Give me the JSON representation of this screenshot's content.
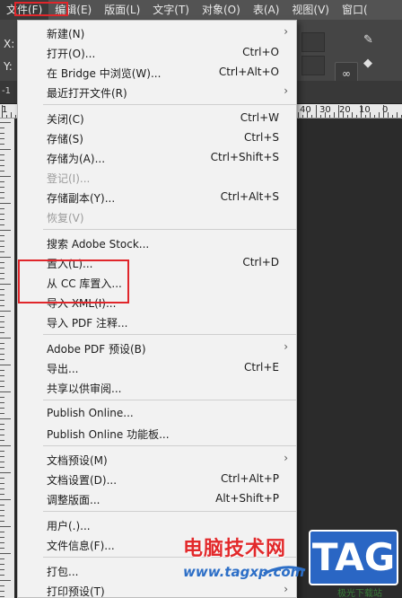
{
  "menubar": {
    "items": [
      "文件(F)",
      "编辑(E)",
      "版面(L)",
      "文字(T)",
      "对象(O)",
      "表(A)",
      "视图(V)",
      "窗口("
    ]
  },
  "control_bar": {
    "x_label": "X:",
    "y_label": "Y:"
  },
  "tabbar": {
    "label": "-1"
  },
  "ruler": {
    "numbers": [
      "1",
      "40",
      "30",
      "20",
      "10",
      "0"
    ]
  },
  "file_menu": {
    "items": [
      {
        "label": "新建(N)",
        "shortcut": "",
        "submenu": true,
        "disabled": false
      },
      {
        "label": "打开(O)...",
        "shortcut": "Ctrl+O",
        "submenu": false,
        "disabled": false
      },
      {
        "label": "在 Bridge 中浏览(W)...",
        "shortcut": "Ctrl+Alt+O",
        "submenu": false,
        "disabled": false
      },
      {
        "label": "最近打开文件(R)",
        "shortcut": "",
        "submenu": true,
        "disabled": false
      },
      {
        "label": "关闭(C)",
        "shortcut": "Ctrl+W",
        "submenu": false,
        "disabled": false
      },
      {
        "label": "存储(S)",
        "shortcut": "Ctrl+S",
        "submenu": false,
        "disabled": false
      },
      {
        "label": "存储为(A)...",
        "shortcut": "Ctrl+Shift+S",
        "submenu": false,
        "disabled": false
      },
      {
        "label": "登记(I)...",
        "shortcut": "",
        "submenu": false,
        "disabled": true
      },
      {
        "label": "存储副本(Y)...",
        "shortcut": "Ctrl+Alt+S",
        "submenu": false,
        "disabled": false
      },
      {
        "label": "恢复(V)",
        "shortcut": "",
        "submenu": false,
        "disabled": true
      },
      {
        "label": "搜索 Adobe Stock...",
        "shortcut": "",
        "submenu": false,
        "disabled": false
      },
      {
        "label": "置入(L)...",
        "shortcut": "Ctrl+D",
        "submenu": false,
        "disabled": false
      },
      {
        "label": "从 CC 库置入...",
        "shortcut": "",
        "submenu": false,
        "disabled": false
      },
      {
        "label": "导入 XML(I)...",
        "shortcut": "",
        "submenu": false,
        "disabled": false
      },
      {
        "label": "导入 PDF 注释...",
        "shortcut": "",
        "submenu": false,
        "disabled": false
      },
      {
        "label": "Adobe PDF 预设(B)",
        "shortcut": "",
        "submenu": true,
        "disabled": false
      },
      {
        "label": "导出...",
        "shortcut": "Ctrl+E",
        "submenu": false,
        "disabled": false
      },
      {
        "label": "共享以供审阅...",
        "shortcut": "",
        "submenu": false,
        "disabled": false
      },
      {
        "label": "Publish Online...",
        "shortcut": "",
        "submenu": false,
        "disabled": false
      },
      {
        "label": "Publish Online 功能板...",
        "shortcut": "",
        "submenu": false,
        "disabled": false
      },
      {
        "label": "文档预设(M)",
        "shortcut": "",
        "submenu": true,
        "disabled": false
      },
      {
        "label": "文档设置(D)...",
        "shortcut": "Ctrl+Alt+P",
        "submenu": false,
        "disabled": false
      },
      {
        "label": "调整版面...",
        "shortcut": "Alt+Shift+P",
        "submenu": false,
        "disabled": false
      },
      {
        "label": "用户(.)...",
        "shortcut": "",
        "submenu": false,
        "disabled": false
      },
      {
        "label": "文件信息(F)...",
        "shortcut": "",
        "submenu": false,
        "disabled": false
      },
      {
        "label": "打包...",
        "shortcut": "",
        "submenu": false,
        "disabled": false
      },
      {
        "label": "打印预设(T)",
        "shortcut": "",
        "submenu": true,
        "disabled": false
      }
    ]
  },
  "watermark": {
    "text": "电脑技术网",
    "url": "www.tagxp.com",
    "logo": "TAG",
    "small": "极光下载站"
  },
  "colors": {
    "highlight": "#e0262b",
    "menu_bg": "#f2f2f2",
    "menubar_bg": "#535353",
    "watermark_red": "#e2292b",
    "watermark_blue": "#2a66c4"
  }
}
